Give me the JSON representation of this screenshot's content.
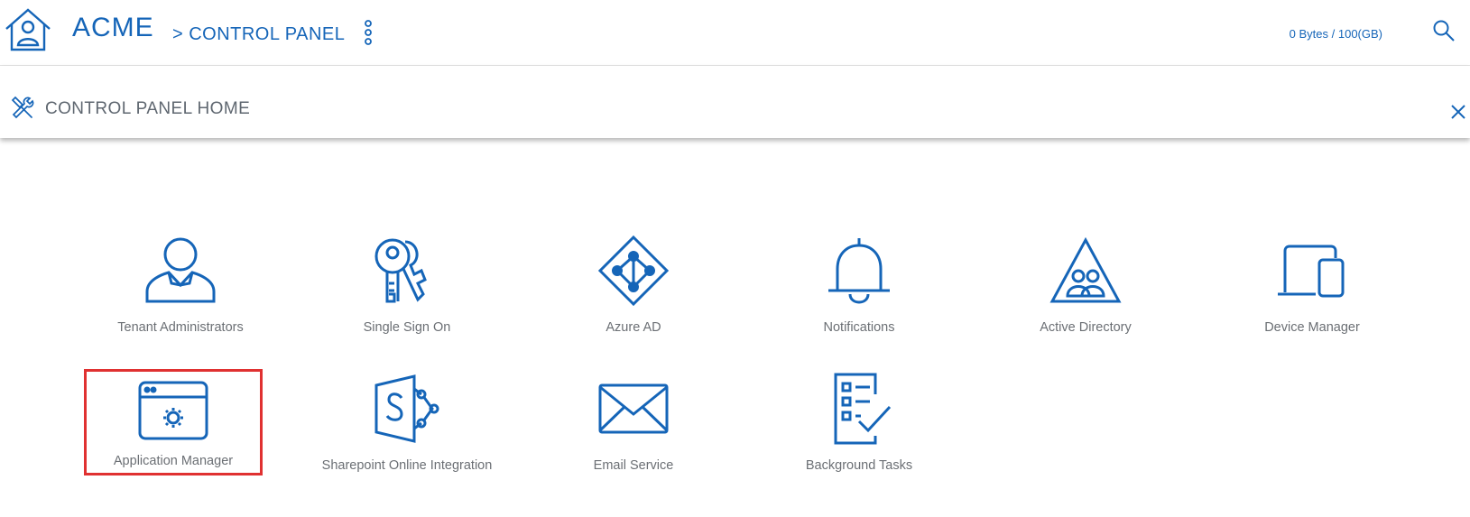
{
  "header": {
    "brand": "ACME",
    "breadcrumb_sep": ">",
    "breadcrumb": "CONTROL PANEL",
    "storage": "0 Bytes / 100(GB)"
  },
  "subheader": {
    "title": "CONTROL PANEL HOME"
  },
  "tiles": [
    {
      "label": "Tenant Administrators",
      "icon": "administrator-icon"
    },
    {
      "label": "Single Sign On",
      "icon": "keys-icon"
    },
    {
      "label": "Azure AD",
      "icon": "azure-ad-icon"
    },
    {
      "label": "Notifications",
      "icon": "bell-icon"
    },
    {
      "label": "Active Directory",
      "icon": "active-directory-icon"
    },
    {
      "label": "Device Manager",
      "icon": "devices-icon"
    },
    {
      "label": "Application Manager",
      "icon": "app-window-gear-icon",
      "selected": true
    },
    {
      "label": "Sharepoint Online Integration",
      "icon": "sharepoint-icon"
    },
    {
      "label": "Email Service",
      "icon": "envelope-icon"
    },
    {
      "label": "Background Tasks",
      "icon": "checklist-icon"
    }
  ],
  "colors": {
    "accent": "#1565b8",
    "label": "#6b6f74",
    "highlight": "#e03131"
  }
}
